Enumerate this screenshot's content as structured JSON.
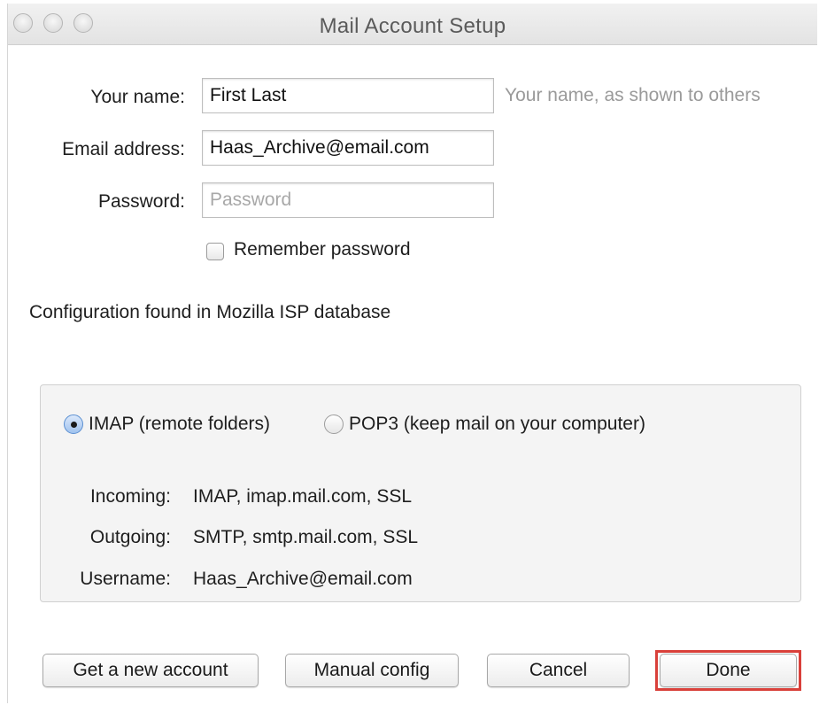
{
  "window": {
    "title": "Mail Account Setup"
  },
  "form": {
    "name_label": "Your name:",
    "name_value": "First Last",
    "name_hint": "Your name, as shown to others",
    "email_label": "Email address:",
    "email_value": "Haas_Archive@email.com",
    "password_label": "Password:",
    "password_placeholder": "Password",
    "remember_label": "Remember password",
    "remember_checked": false
  },
  "status": {
    "config_text": "Configuration found in Mozilla ISP database"
  },
  "server": {
    "protocol_selected": "IMAP",
    "imap_label": "IMAP (remote folders)",
    "pop3_label": "POP3 (keep mail on your computer)",
    "incoming_label": "Incoming:",
    "incoming_value": "IMAP, imap.mail.com, SSL",
    "outgoing_label": "Outgoing:",
    "outgoing_value": "SMTP, smtp.mail.com, SSL",
    "username_label": "Username:",
    "username_value": "Haas_Archive@email.com"
  },
  "buttons": {
    "new_account": "Get a new account",
    "manual_config": "Manual config",
    "cancel": "Cancel",
    "done": "Done"
  },
  "colors": {
    "highlight": "#d9403a",
    "radio_selected": "#5b8fd1"
  }
}
